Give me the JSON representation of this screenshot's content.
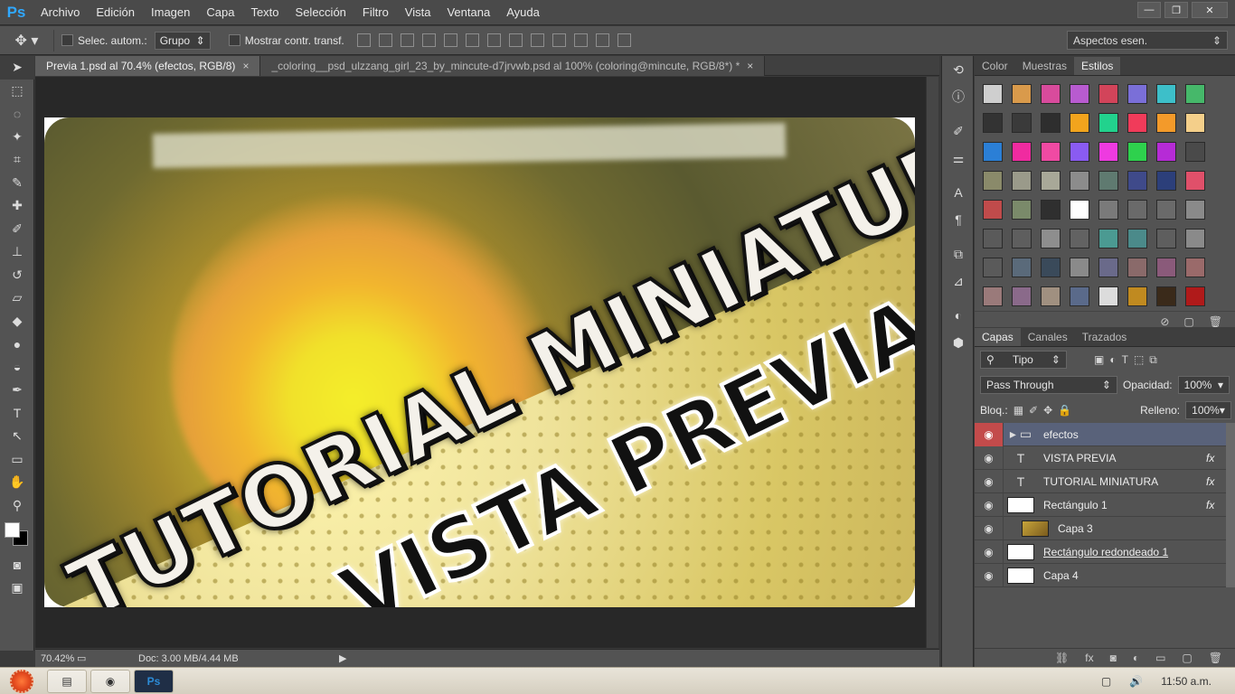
{
  "app": {
    "logo": "Ps"
  },
  "menu": [
    "Archivo",
    "Edición",
    "Imagen",
    "Capa",
    "Texto",
    "Selección",
    "Filtro",
    "Vista",
    "Ventana",
    "Ayuda"
  ],
  "window_controls": {
    "minimize": "—",
    "restore": "❐",
    "close": "✕"
  },
  "options": {
    "tool_icon": "move-tool-icon",
    "auto_select_label": "Selec. autom.:",
    "auto_select_value": "Grupo",
    "show_transform_label": "Mostrar contr. transf.",
    "workspace": "Aspectos esen."
  },
  "tabs": [
    {
      "label": "Previa 1.psd al 70.4% (efectos, RGB/8)",
      "close": "×"
    },
    {
      "label": "_coloring__psd_ulzzang_girl_23_by_mincute-d7jrvwb.psd al 100% (coloring@mincute, RGB/8*) *",
      "close": "×"
    }
  ],
  "canvas": {
    "line1": "TUTORIAL MINIATURA",
    "line2": "VISTA PREVIA"
  },
  "status": {
    "zoom": "70.42%",
    "doc": "Doc: 3.00 MB/4.44 MB"
  },
  "styles_panel": {
    "tabs": [
      "Color",
      "Muestras",
      "Estilos"
    ],
    "swatches": [
      "#cfcfcf",
      "#d99a4b",
      "#d84b9c",
      "#b85bd0",
      "#d2445a",
      "#7a6fd8",
      "#3dbfc9",
      "#46b86a",
      "#333333",
      "#3a3a3a",
      "#2e2e2e",
      "#f2a41d",
      "#22d28d",
      "#f03b5a",
      "#f39a2a",
      "#f4cf8a",
      "#2b7fd6",
      "#f02ba0",
      "#f04aa3",
      "#8a5bf2",
      "#ee3ae0",
      "#2ed14d",
      "#b62bd6",
      "#4a4a4a",
      "#8a8a6a",
      "#9a9a8a",
      "#a8a898",
      "#8c8c8c",
      "#5f7a70",
      "#3f4a8a",
      "#2c3f7a",
      "#e0506a",
      "#c04b4b",
      "#7a8a6a",
      "#2f2f2f",
      "#ffffff",
      "#7a7a7a",
      "#6a6a6a",
      "#6a6a6a",
      "#8a8a8a",
      "#5a5a5a",
      "#5e5e5e",
      "#8e8e8e",
      "#626262",
      "#4b9a92",
      "#4b8a8a",
      "#5e5e5e",
      "#8a8a8a",
      "#5a5a5a",
      "#5a6a7a",
      "#3a4a5a",
      "#8a8a8a",
      "#6a6a8a",
      "#8a6a6a",
      "#8a5a7a",
      "#9a6a6a",
      "#9a7a7a",
      "#8a6a8a",
      "#a09080",
      "#5a6a8a",
      "#dcdcdc",
      "#c08a20",
      "#3a2a1a",
      "#b01a1a"
    ]
  },
  "layers_panel": {
    "tabs": [
      "Capas",
      "Canales",
      "Trazados"
    ],
    "filter": "Tipo",
    "blend_mode": "Pass Through",
    "opacity_label": "Opacidad:",
    "opacity": "100%",
    "lock_label": "Bloq.:",
    "fill_label": "Relleno:",
    "fill": "100%",
    "layers": [
      {
        "name": "efectos",
        "kind": "group",
        "fx": ""
      },
      {
        "name": "VISTA PREVIA",
        "kind": "text",
        "fx": "fx"
      },
      {
        "name": "TUTORIAL MINIATURA",
        "kind": "text",
        "fx": "fx"
      },
      {
        "name": "Rectángulo 1",
        "kind": "shape",
        "fx": "fx"
      },
      {
        "name": "Capa 3",
        "kind": "image",
        "fx": ""
      },
      {
        "name": "Rectángulo redondeado 1",
        "kind": "shape",
        "fx": ""
      },
      {
        "name": "Capa 4",
        "kind": "white",
        "fx": ""
      }
    ]
  },
  "taskbar": {
    "clock": "11:50 a.m."
  }
}
